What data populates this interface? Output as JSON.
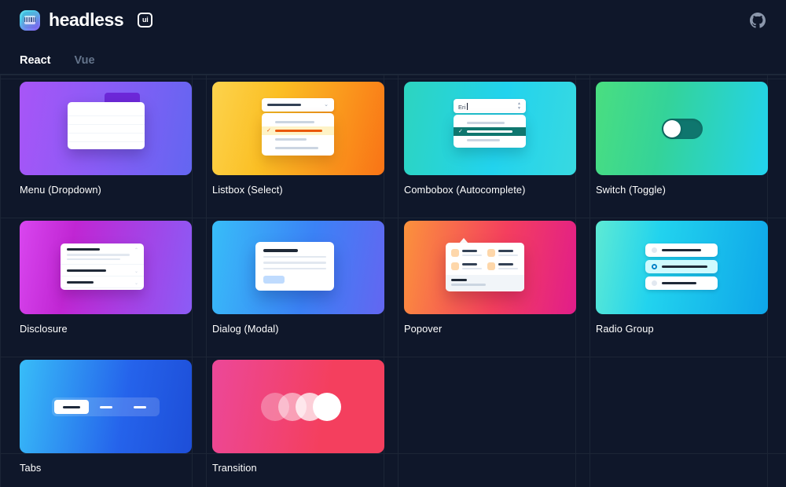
{
  "header": {
    "brand_name": "headless",
    "brand_badge": "ui",
    "logo_icon": "headlessui-logo-icon",
    "github_icon": "github-icon"
  },
  "tabs": [
    {
      "label": "React",
      "active": true
    },
    {
      "label": "Vue",
      "active": false
    }
  ],
  "components": [
    {
      "label": "Menu (Dropdown)",
      "art": "menu",
      "colors": {
        "from": "#a855f7",
        "to": "#6366f1"
      }
    },
    {
      "label": "Listbox (Select)",
      "art": "listbox",
      "colors": {
        "from": "#fcd34d",
        "to": "#f97316"
      }
    },
    {
      "label": "Combobox (Autocomplete)",
      "art": "combobox",
      "colors": {
        "from": "#2dd4bf",
        "to": "#38d9e0"
      }
    },
    {
      "label": "Switch (Toggle)",
      "art": "switch",
      "colors": {
        "from": "#4ade80",
        "to": "#22d3ee"
      }
    },
    {
      "label": "Disclosure",
      "art": "disclosure",
      "colors": {
        "from": "#d946ef",
        "to": "#8b5cf6"
      }
    },
    {
      "label": "Dialog (Modal)",
      "art": "dialog",
      "colors": {
        "from": "#38bdf8",
        "to": "#6366f1"
      }
    },
    {
      "label": "Popover",
      "art": "popover",
      "colors": {
        "from": "#fb923c",
        "to": "#e11d8a"
      }
    },
    {
      "label": "Radio Group",
      "art": "radiogroup",
      "colors": {
        "from": "#5eead4",
        "to": "#0ea5e9"
      }
    },
    {
      "label": "Tabs",
      "art": "tabs",
      "colors": {
        "from": "#38bdf8",
        "to": "#1d4ed8"
      }
    },
    {
      "label": "Transition",
      "art": "transition",
      "colors": {
        "from": "#ec4899",
        "to": "#f43f5e"
      }
    }
  ],
  "art": {
    "combobox": {
      "input_value": "Eri"
    }
  },
  "theme": {
    "background": "#0f172a",
    "gridline": "#1c2536",
    "text": "#ffffff",
    "text_muted": "#64748b",
    "accent_underline": "#ffffff"
  }
}
